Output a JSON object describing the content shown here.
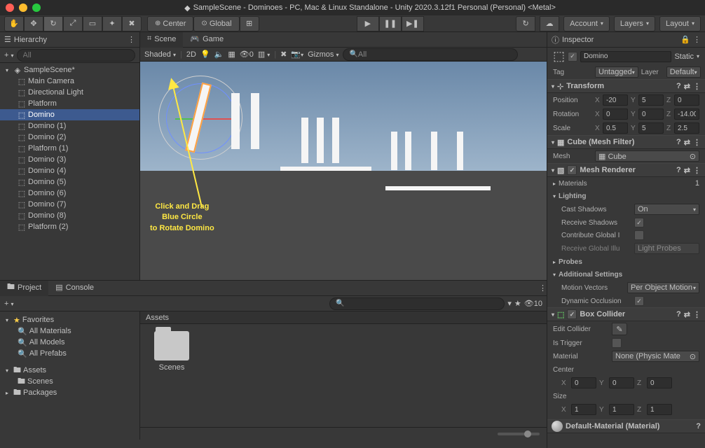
{
  "title": "SampleScene - Dominoes - PC, Mac & Linux Standalone - Unity 2020.3.12f1 Personal (Personal) <Metal>",
  "toolbar": {
    "pivot_mode": "Center",
    "handle_mode": "Global",
    "menus": {
      "account": "Account",
      "layers": "Layers",
      "layout": "Layout"
    }
  },
  "hierarchy": {
    "title": "Hierarchy",
    "search_placeholder": "All",
    "scene_name": "SampleScene*",
    "items": [
      {
        "label": "Main Camera"
      },
      {
        "label": "Directional Light"
      },
      {
        "label": "Platform"
      },
      {
        "label": "Domino",
        "selected": true
      },
      {
        "label": "Domino (1)"
      },
      {
        "label": "Domino (2)"
      },
      {
        "label": "Platform (1)"
      },
      {
        "label": "Domino (3)"
      },
      {
        "label": "Domino (4)"
      },
      {
        "label": "Domino (5)"
      },
      {
        "label": "Domino (6)"
      },
      {
        "label": "Domino (7)"
      },
      {
        "label": "Domino (8)"
      },
      {
        "label": "Platform (2)"
      }
    ]
  },
  "scene_tabs": {
    "scene": "Scene",
    "game": "Game"
  },
  "scene_toolbar": {
    "shading": "Shaded",
    "gizmos": "Gizmos",
    "search_placeholder": "All"
  },
  "annotation": {
    "line1": "Click  and  Drag",
    "line2": "Blue  Circle",
    "line3": "to  Rotate  Domino"
  },
  "project": {
    "tab_project": "Project",
    "tab_console": "Console",
    "favorites": "Favorites",
    "fav_items": [
      "All Materials",
      "All Models",
      "All Prefabs"
    ],
    "assets": "Assets",
    "assets_children": [
      "Scenes"
    ],
    "packages": "Packages",
    "main_head": "Assets",
    "folder_label": "Scenes",
    "counter": "10"
  },
  "inspector": {
    "title": "Inspector",
    "object_name": "Domino",
    "static_label": "Static",
    "tag_label": "Tag",
    "tag_value": "Untagged",
    "layer_label": "Layer",
    "layer_value": "Default",
    "transform": {
      "title": "Transform",
      "position": {
        "label": "Position",
        "x": "-20",
        "y": "5",
        "z": "0"
      },
      "rotation": {
        "label": "Rotation",
        "x": "0",
        "y": "0",
        "z": "-14.00"
      },
      "scale": {
        "label": "Scale",
        "x": "0.5",
        "y": "5",
        "z": "2.5"
      }
    },
    "mesh_filter": {
      "title": "Cube (Mesh Filter)",
      "mesh_label": "Mesh",
      "mesh_value": "Cube"
    },
    "mesh_renderer": {
      "title": "Mesh Renderer",
      "materials_label": "Materials",
      "materials_count": "1",
      "lighting_label": "Lighting",
      "cast_shadows_label": "Cast Shadows",
      "cast_shadows": "On",
      "receive_shadows_label": "Receive Shadows",
      "contribute_gi_label": "Contribute Global I",
      "receive_gi_label": "Receive Global Illu",
      "receive_gi": "Light Probes",
      "probes_label": "Probes",
      "additional_label": "Additional Settings",
      "motion_label": "Motion Vectors",
      "motion_value": "Per Object Motion",
      "dynamic_occlusion_label": "Dynamic Occlusion"
    },
    "box_collider": {
      "title": "Box Collider",
      "edit_collider_label": "Edit Collider",
      "is_trigger_label": "Is Trigger",
      "material_label": "Material",
      "material_value": "None (Physic Mate",
      "center_label": "Center",
      "center": {
        "x": "0",
        "y": "0",
        "z": "0"
      },
      "size_label": "Size",
      "size": {
        "x": "1",
        "y": "1",
        "z": "1"
      }
    },
    "default_material": "Default-Material (Material)"
  }
}
